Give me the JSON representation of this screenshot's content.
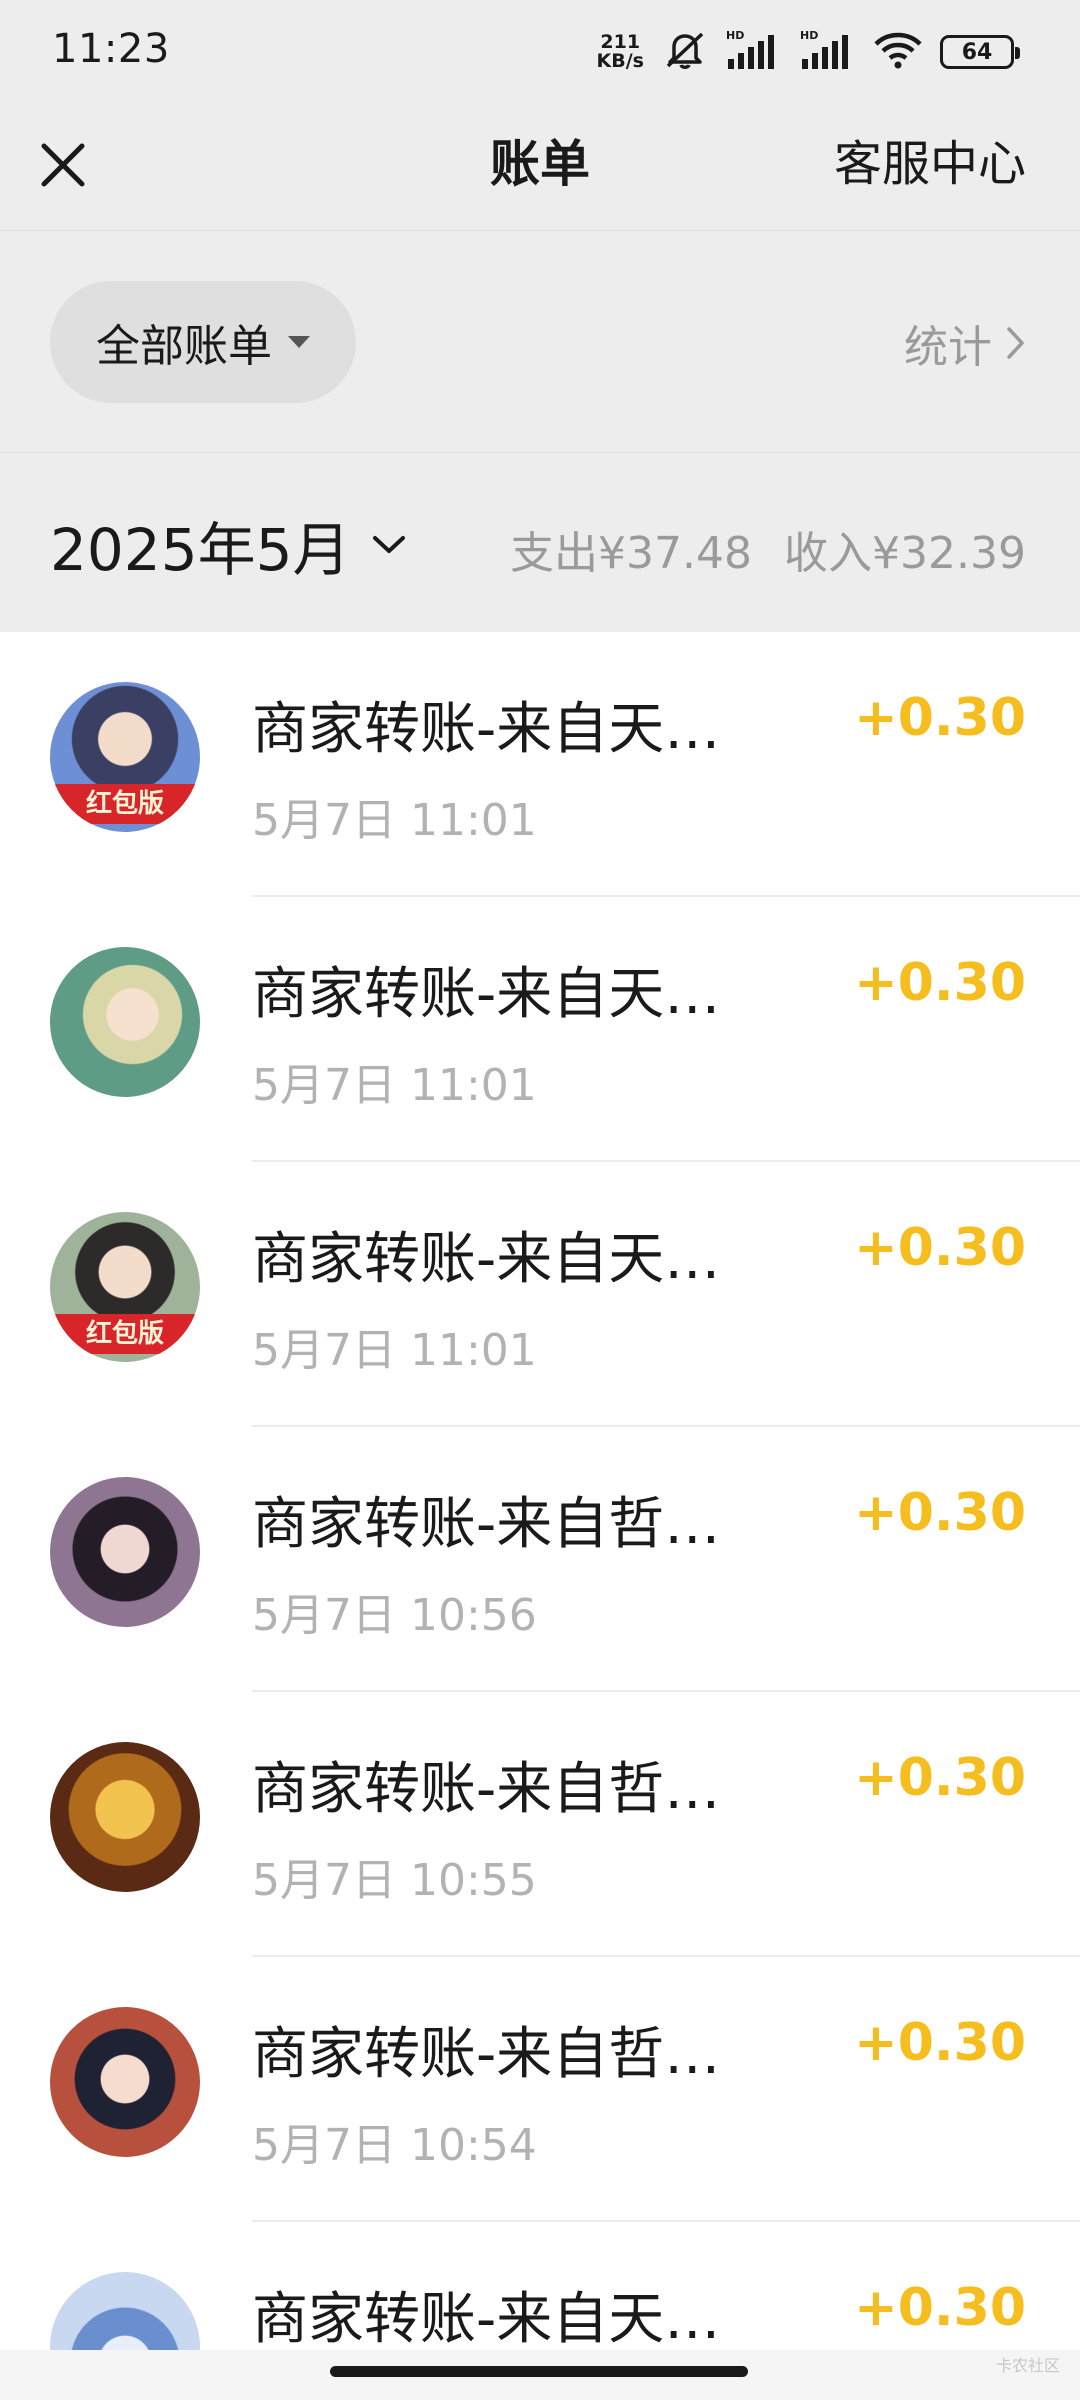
{
  "status_bar": {
    "time": "11:23",
    "net_speed_value": "211",
    "net_speed_unit": "KB/s",
    "signal_label": "HD",
    "battery": "64"
  },
  "nav": {
    "title": "账单",
    "service": "客服中心"
  },
  "filter": {
    "label": "全部账单",
    "stats": "统计"
  },
  "month": {
    "label": "2025年5月",
    "expense": "支出¥37.48",
    "income": "收入¥32.39"
  },
  "bills": [
    {
      "title": "商家转账-来自天…",
      "time": "5月7日 11:01",
      "amount": "+0.30",
      "badge": "红包版",
      "avatar_color": "#5a7fc7"
    },
    {
      "title": "商家转账-来自天…",
      "time": "5月7日 11:01",
      "amount": "+0.30",
      "badge": "",
      "avatar_color": "#6fae8e"
    },
    {
      "title": "商家转账-来自天…",
      "time": "5月7日 11:01",
      "amount": "+0.30",
      "badge": "红包版",
      "avatar_color": "#7f9c7a"
    },
    {
      "title": "商家转账-来自哲…",
      "time": "5月7日 10:56",
      "amount": "+0.30",
      "badge": "",
      "avatar_color": "#6b5068"
    },
    {
      "title": "商家转账-来自哲…",
      "time": "5月7日 10:55",
      "amount": "+0.30",
      "badge": "",
      "avatar_color": "#b9762a"
    },
    {
      "title": "商家转账-来自哲…",
      "time": "5月7日 10:54",
      "amount": "+0.30",
      "badge": "",
      "avatar_color": "#a5444a"
    },
    {
      "title": "商家转账-来自天…",
      "time": "",
      "amount": "+0.30",
      "badge": "",
      "avatar_color": "#8fb0dc"
    }
  ],
  "watermark": "卡农社区",
  "colors": {
    "amount": "#f5bd1e",
    "background": "#ededed",
    "list_background": "#ffffff"
  }
}
